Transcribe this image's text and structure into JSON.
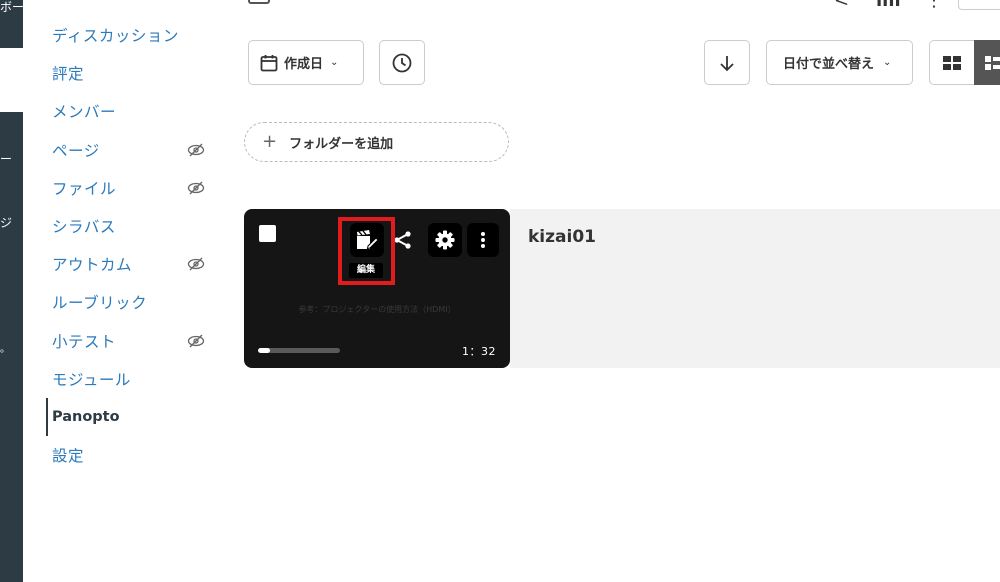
{
  "rail": {
    "items": [
      "ボー",
      "ー",
      "ジ",
      "。"
    ]
  },
  "nav": {
    "items": [
      {
        "label": "ディスカッション",
        "hidden": false
      },
      {
        "label": "評定",
        "hidden": false
      },
      {
        "label": "メンバー",
        "hidden": false
      },
      {
        "label": "ページ",
        "hidden": true
      },
      {
        "label": "ファイル",
        "hidden": true
      },
      {
        "label": "シラバス",
        "hidden": false
      },
      {
        "label": "アウトカム",
        "hidden": true
      },
      {
        "label": "ルーブリック",
        "hidden": false
      },
      {
        "label": "小テスト",
        "hidden": true
      },
      {
        "label": "モジュール",
        "hidden": false
      },
      {
        "label": "Panopto",
        "hidden": false,
        "active": true
      },
      {
        "label": "設定",
        "hidden": false
      }
    ]
  },
  "toolbar": {
    "date_filter_label": "作成日",
    "sort_label": "日付で並べ替え",
    "folder_button_label": "フォルダーを追加"
  },
  "video": {
    "title": "kizai01",
    "duration": "1：32",
    "edit_tooltip": "編集",
    "thumbnail_caption": "参考：プロジェクターの使用方法（HDMI）",
    "progress": 0.15
  },
  "colors": {
    "link": "#2b7abc",
    "rail": "#2d3b45",
    "highlight": "#e01c1c"
  }
}
